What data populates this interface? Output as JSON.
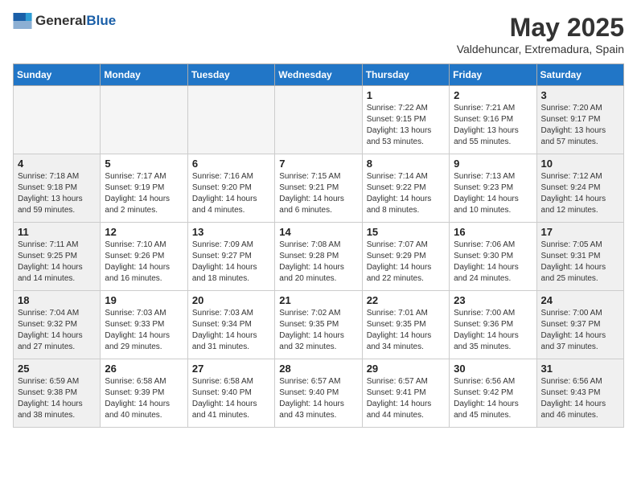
{
  "header": {
    "logo_general": "General",
    "logo_blue": "Blue",
    "month": "May 2025",
    "location": "Valdehuncar, Extremadura, Spain"
  },
  "days_of_week": [
    "Sunday",
    "Monday",
    "Tuesday",
    "Wednesday",
    "Thursday",
    "Friday",
    "Saturday"
  ],
  "weeks": [
    [
      {
        "day": "",
        "info": ""
      },
      {
        "day": "",
        "info": ""
      },
      {
        "day": "",
        "info": ""
      },
      {
        "day": "",
        "info": ""
      },
      {
        "day": "1",
        "info": "Sunrise: 7:22 AM\nSunset: 9:15 PM\nDaylight: 13 hours\nand 53 minutes."
      },
      {
        "day": "2",
        "info": "Sunrise: 7:21 AM\nSunset: 9:16 PM\nDaylight: 13 hours\nand 55 minutes."
      },
      {
        "day": "3",
        "info": "Sunrise: 7:20 AM\nSunset: 9:17 PM\nDaylight: 13 hours\nand 57 minutes."
      }
    ],
    [
      {
        "day": "4",
        "info": "Sunrise: 7:18 AM\nSunset: 9:18 PM\nDaylight: 13 hours\nand 59 minutes."
      },
      {
        "day": "5",
        "info": "Sunrise: 7:17 AM\nSunset: 9:19 PM\nDaylight: 14 hours\nand 2 minutes."
      },
      {
        "day": "6",
        "info": "Sunrise: 7:16 AM\nSunset: 9:20 PM\nDaylight: 14 hours\nand 4 minutes."
      },
      {
        "day": "7",
        "info": "Sunrise: 7:15 AM\nSunset: 9:21 PM\nDaylight: 14 hours\nand 6 minutes."
      },
      {
        "day": "8",
        "info": "Sunrise: 7:14 AM\nSunset: 9:22 PM\nDaylight: 14 hours\nand 8 minutes."
      },
      {
        "day": "9",
        "info": "Sunrise: 7:13 AM\nSunset: 9:23 PM\nDaylight: 14 hours\nand 10 minutes."
      },
      {
        "day": "10",
        "info": "Sunrise: 7:12 AM\nSunset: 9:24 PM\nDaylight: 14 hours\nand 12 minutes."
      }
    ],
    [
      {
        "day": "11",
        "info": "Sunrise: 7:11 AM\nSunset: 9:25 PM\nDaylight: 14 hours\nand 14 minutes."
      },
      {
        "day": "12",
        "info": "Sunrise: 7:10 AM\nSunset: 9:26 PM\nDaylight: 14 hours\nand 16 minutes."
      },
      {
        "day": "13",
        "info": "Sunrise: 7:09 AM\nSunset: 9:27 PM\nDaylight: 14 hours\nand 18 minutes."
      },
      {
        "day": "14",
        "info": "Sunrise: 7:08 AM\nSunset: 9:28 PM\nDaylight: 14 hours\nand 20 minutes."
      },
      {
        "day": "15",
        "info": "Sunrise: 7:07 AM\nSunset: 9:29 PM\nDaylight: 14 hours\nand 22 minutes."
      },
      {
        "day": "16",
        "info": "Sunrise: 7:06 AM\nSunset: 9:30 PM\nDaylight: 14 hours\nand 24 minutes."
      },
      {
        "day": "17",
        "info": "Sunrise: 7:05 AM\nSunset: 9:31 PM\nDaylight: 14 hours\nand 25 minutes."
      }
    ],
    [
      {
        "day": "18",
        "info": "Sunrise: 7:04 AM\nSunset: 9:32 PM\nDaylight: 14 hours\nand 27 minutes."
      },
      {
        "day": "19",
        "info": "Sunrise: 7:03 AM\nSunset: 9:33 PM\nDaylight: 14 hours\nand 29 minutes."
      },
      {
        "day": "20",
        "info": "Sunrise: 7:03 AM\nSunset: 9:34 PM\nDaylight: 14 hours\nand 31 minutes."
      },
      {
        "day": "21",
        "info": "Sunrise: 7:02 AM\nSunset: 9:35 PM\nDaylight: 14 hours\nand 32 minutes."
      },
      {
        "day": "22",
        "info": "Sunrise: 7:01 AM\nSunset: 9:35 PM\nDaylight: 14 hours\nand 34 minutes."
      },
      {
        "day": "23",
        "info": "Sunrise: 7:00 AM\nSunset: 9:36 PM\nDaylight: 14 hours\nand 35 minutes."
      },
      {
        "day": "24",
        "info": "Sunrise: 7:00 AM\nSunset: 9:37 PM\nDaylight: 14 hours\nand 37 minutes."
      }
    ],
    [
      {
        "day": "25",
        "info": "Sunrise: 6:59 AM\nSunset: 9:38 PM\nDaylight: 14 hours\nand 38 minutes."
      },
      {
        "day": "26",
        "info": "Sunrise: 6:58 AM\nSunset: 9:39 PM\nDaylight: 14 hours\nand 40 minutes."
      },
      {
        "day": "27",
        "info": "Sunrise: 6:58 AM\nSunset: 9:40 PM\nDaylight: 14 hours\nand 41 minutes."
      },
      {
        "day": "28",
        "info": "Sunrise: 6:57 AM\nSunset: 9:40 PM\nDaylight: 14 hours\nand 43 minutes."
      },
      {
        "day": "29",
        "info": "Sunrise: 6:57 AM\nSunset: 9:41 PM\nDaylight: 14 hours\nand 44 minutes."
      },
      {
        "day": "30",
        "info": "Sunrise: 6:56 AM\nSunset: 9:42 PM\nDaylight: 14 hours\nand 45 minutes."
      },
      {
        "day": "31",
        "info": "Sunrise: 6:56 AM\nSunset: 9:43 PM\nDaylight: 14 hours\nand 46 minutes."
      }
    ]
  ]
}
